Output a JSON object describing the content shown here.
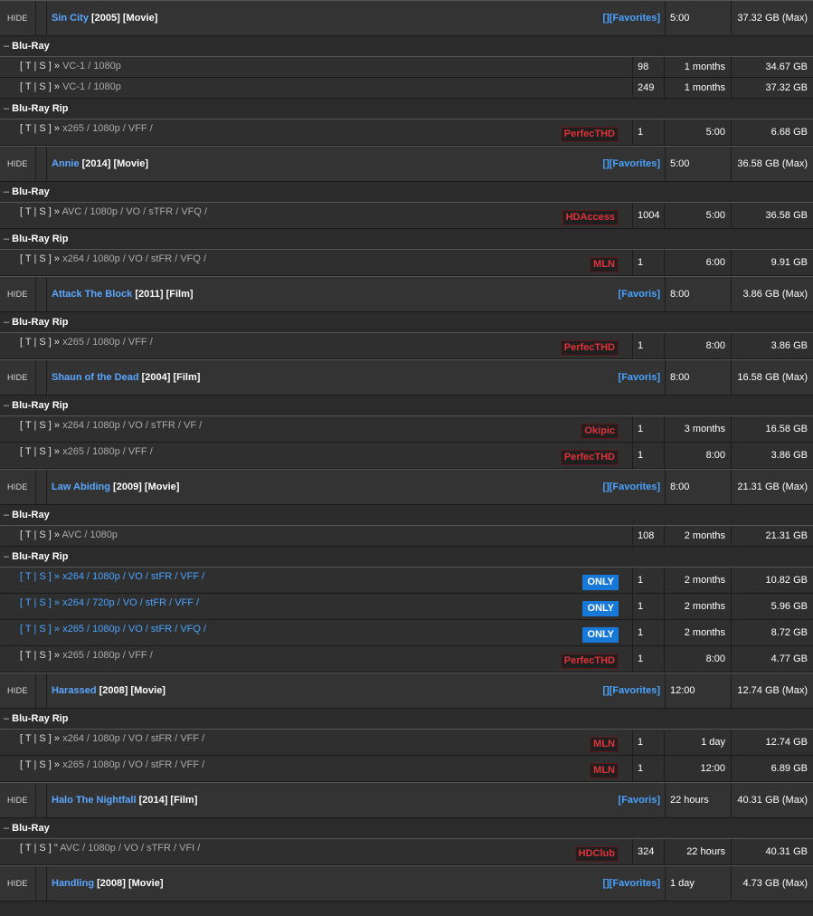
{
  "hide_label": "HIDE",
  "groups": [
    {
      "title": "Sin City",
      "year": "[2005]",
      "type": "[Movie]",
      "fav": "[][Favorites]",
      "time": "5:00",
      "size": "37.32 GB (Max)",
      "sections": [
        {
          "name": "Blu-Ray",
          "releases": [
            {
              "prefix": "[ T | S ] »",
              "info": "VC-1 / 1080p",
              "tag": "",
              "seeds": "98",
              "age": "1 months",
              "size": "34.67 GB"
            },
            {
              "prefix": "[ T | S ] »",
              "info": "VC-1 / 1080p",
              "tag": "",
              "seeds": "249",
              "age": "1 months",
              "size": "37.32 GB"
            }
          ]
        },
        {
          "name": "Blu-Ray Rip",
          "releases": [
            {
              "prefix": "[ T | S ] »",
              "info": "x265 / 1080p / VFF /",
              "tag": "PerfecTHD",
              "seeds": "1",
              "age": "5:00",
              "size": "6.68 GB"
            }
          ]
        }
      ]
    },
    {
      "title": "Annie",
      "year": "[2014]",
      "type": "[Movie]",
      "fav": "[][Favorites]",
      "time": "5:00",
      "size": "36.58 GB (Max)",
      "sections": [
        {
          "name": "Blu-Ray",
          "releases": [
            {
              "prefix": "[ T | S ] »",
              "info": "AVC / 1080p / VO / sTFR / VFQ /",
              "tag": "HDAccess",
              "seeds": "1004",
              "age": "5:00",
              "size": "36.58 GB"
            }
          ]
        },
        {
          "name": "Blu-Ray Rip",
          "releases": [
            {
              "prefix": "[ T | S ] »",
              "info": "x264 / 1080p / VO / stFR / VFQ /",
              "tag": "MLN",
              "seeds": "1",
              "age": "6:00",
              "size": "9.91 GB"
            }
          ]
        }
      ]
    },
    {
      "title": "Attack The Block",
      "year": "[2011]",
      "type": "[Film]",
      "fav": "[Favoris]",
      "time": "8:00",
      "size": "3.86 GB (Max)",
      "sections": [
        {
          "name": "Blu-Ray Rip",
          "releases": [
            {
              "prefix": "[ T | S ] »",
              "info": "x265 / 1080p / VFF /",
              "tag": "PerfecTHD",
              "seeds": "1",
              "age": "8:00",
              "size": "3.86 GB"
            }
          ]
        }
      ]
    },
    {
      "title": "Shaun of the Dead",
      "year": "[2004]",
      "type": "[Film]",
      "fav": "[Favoris]",
      "time": "8:00",
      "size": "16.58 GB (Max)",
      "sections": [
        {
          "name": "Blu-Ray Rip",
          "releases": [
            {
              "prefix": "[ T | S ] »",
              "info": "x264 / 1080p / VO / sTFR / VF /",
              "tag": "Okipic",
              "seeds": "1",
              "age": "3 months",
              "size": "16.58 GB"
            },
            {
              "prefix": "[ T | S ] »",
              "info": "x265 / 1080p / VFF /",
              "tag": "PerfecTHD",
              "seeds": "1",
              "age": "8:00",
              "size": "3.86 GB"
            }
          ]
        }
      ]
    },
    {
      "title": "Law Abiding",
      "year": "[2009]",
      "type": "[Movie]",
      "fav": "[][Favorites]",
      "time": "8:00",
      "size": "21.31 GB (Max)",
      "sections": [
        {
          "name": "Blu-Ray",
          "releases": [
            {
              "prefix": "[ T | S ] »",
              "info": "AVC / 1080p",
              "tag": "",
              "seeds": "108",
              "age": "2 months",
              "size": "21.31 GB"
            }
          ]
        },
        {
          "name": "Blu-Ray Rip",
          "releases": [
            {
              "prefix": "[ T | S ] »",
              "info": "x264 / 1080p / VO / stFR / VFF /",
              "tag": "ONLY",
              "only": true,
              "seeds": "1",
              "age": "2 months",
              "size": "10.82 GB"
            },
            {
              "prefix": "[ T | S ] »",
              "info": "x264 / 720p / VO / stFR / VFF /",
              "tag": "ONLY",
              "only": true,
              "seeds": "1",
              "age": "2 months",
              "size": "5.96 GB"
            },
            {
              "prefix": "[ T | S ] »",
              "info": "x265 / 1080p / VO / stFR / VFQ /",
              "tag": "ONLY",
              "only": true,
              "seeds": "1",
              "age": "2 months",
              "size": "8.72 GB"
            },
            {
              "prefix": "[ T | S ] »",
              "info": "x265 / 1080p / VFF /",
              "tag": "PerfecTHD",
              "seeds": "1",
              "age": "8:00",
              "size": "4.77 GB"
            }
          ]
        }
      ]
    },
    {
      "title": "Harassed",
      "year": "[2008]",
      "type": "[Movie]",
      "fav": "[][Favorites]",
      "time": "12:00",
      "size": "12.74 GB (Max)",
      "sections": [
        {
          "name": "Blu-Ray Rip",
          "releases": [
            {
              "prefix": "[ T | S ] »",
              "info": "x264 / 1080p / VO / stFR / VFF /",
              "tag": "MLN",
              "seeds": "1",
              "age": "1 day",
              "size": "12.74 GB"
            },
            {
              "prefix": "[ T | S ] »",
              "info": "x265 / 1080p / VO / stFR / VFF /",
              "tag": "MLN",
              "seeds": "1",
              "age": "12:00",
              "size": "6.89 GB"
            }
          ]
        }
      ]
    },
    {
      "title": "Halo The Nightfall",
      "year": "[2014]",
      "type": "[Film]",
      "fav": "[Favoris]",
      "time": "22 hours",
      "size": "40.31 GB (Max)",
      "sections": [
        {
          "name": "Blu-Ray",
          "releases": [
            {
              "prefix": "[ T | S ] \"",
              "info": "AVC / 1080p / VO / sTFR / VFI /",
              "tag": "HDClub",
              "seeds": "324",
              "age": "22 hours",
              "size": "40.31 GB"
            }
          ]
        }
      ]
    },
    {
      "title": "Handling",
      "year": "[2008]",
      "type": "[Movie]",
      "fav": "[][Favorites]",
      "time": "1 day",
      "size": "4.73 GB (Max)",
      "sections": []
    }
  ]
}
